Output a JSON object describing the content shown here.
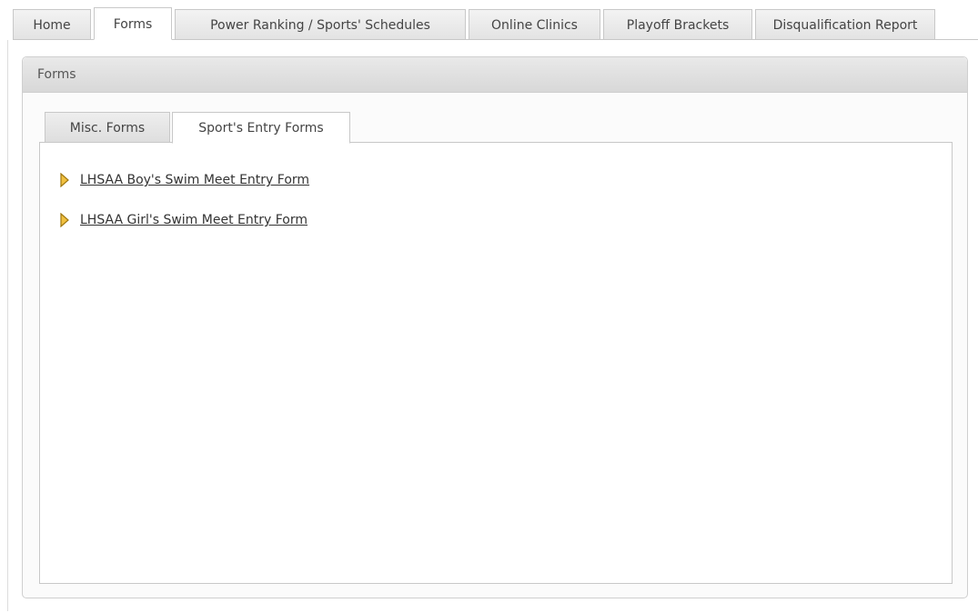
{
  "top_nav": {
    "tabs": [
      {
        "label": "Home"
      },
      {
        "label": "Forms"
      },
      {
        "label": "Power Ranking / Sports' Schedules"
      },
      {
        "label": "Online Clinics"
      },
      {
        "label": "Playoff Brackets"
      },
      {
        "label": "Disqualification Report"
      }
    ],
    "active": "Forms"
  },
  "panel": {
    "title": "Forms",
    "tabs": [
      {
        "label": "Misc. Forms"
      },
      {
        "label": "Sport's Entry Forms"
      }
    ],
    "active_tab": "Sport's Entry Forms",
    "links": [
      {
        "label": "LHSAA Boy's Swim Meet Entry Form",
        "icon": "arrow-bullet-icon"
      },
      {
        "label": "LHSAA Girl's Swim Meet Entry Form",
        "icon": "arrow-bullet-icon"
      }
    ]
  },
  "colors": {
    "bullet": "#d9a520",
    "tab_border": "#c8c8c8",
    "panel_header": "#dedede"
  }
}
